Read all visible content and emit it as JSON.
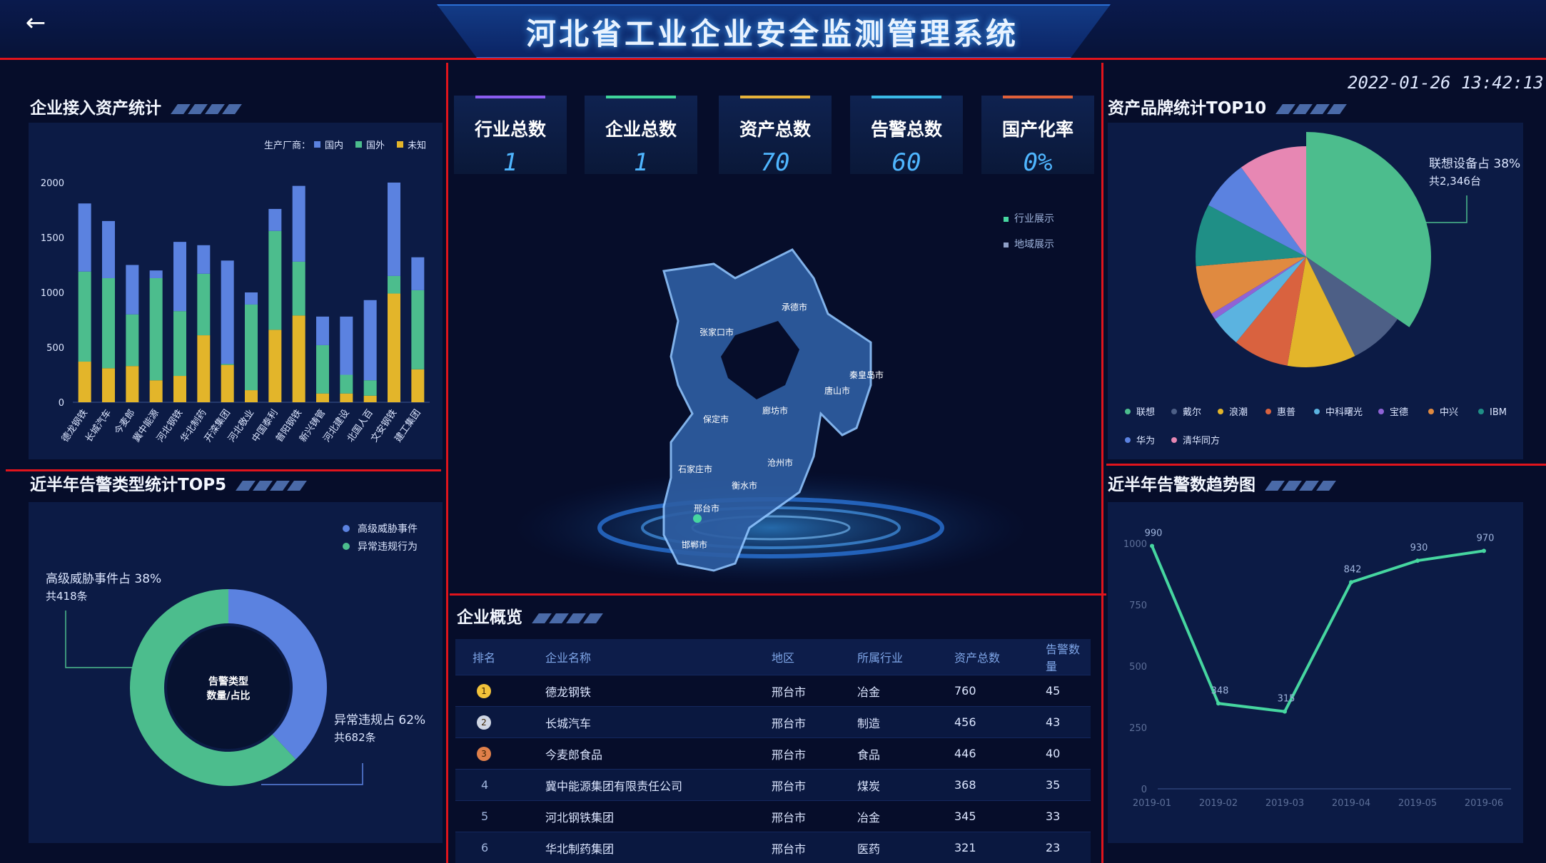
{
  "header": {
    "title": "河北省工业企业安全监测管理系统",
    "back_icon": "←"
  },
  "clock": "2022-01-26 13:42:13",
  "asset_panel": {
    "title": "企业接入资产统计",
    "legend_prefix": "生产厂商：",
    "chart_data": {
      "type": "bar",
      "stacked": true,
      "categories": [
        "德龙钢铁",
        "长城汽车",
        "今麦郎",
        "冀中能源",
        "河北钢铁",
        "华北制药",
        "开滦集团",
        "河北敬业",
        "中国泰利",
        "普阳钢铁",
        "新兴铸管",
        "河北建设",
        "北国人百",
        "文安钢铁",
        "建工集团"
      ],
      "series": [
        {
          "name": "国内",
          "color": "#5b82e0",
          "values": [
            620,
            520,
            450,
            70,
            630,
            260,
            940,
            110,
            200,
            690,
            260,
            530,
            730,
            850,
            300
          ]
        },
        {
          "name": "国外",
          "color": "#4cbd8d",
          "values": [
            820,
            820,
            470,
            930,
            590,
            560,
            10,
            780,
            900,
            490,
            440,
            170,
            140,
            160,
            720
          ]
        },
        {
          "name": "未知",
          "color": "#e3b52a",
          "values": [
            370,
            310,
            330,
            200,
            240,
            610,
            340,
            110,
            660,
            790,
            80,
            80,
            60,
            990,
            300
          ]
        }
      ],
      "ylim": [
        0,
        2000
      ],
      "yticks": [
        0,
        500,
        1000,
        1500,
        2000
      ],
      "grid": false
    }
  },
  "alarm_type_panel": {
    "title": "近半年告警类型统计TOP5",
    "center_label_1": "告警类型",
    "center_label_2": "数量/占比",
    "callout_a_1": "高级威胁事件占 38%",
    "callout_a_2": "共418条",
    "callout_b_1": "异常违规占 62%",
    "callout_b_2": "共682条",
    "chart_data": {
      "type": "pie",
      "donut": true,
      "slices": [
        {
          "name": "高级威胁事件",
          "value": 418,
          "percent": 38,
          "color": "#5b82e0"
        },
        {
          "name": "异常违规行为",
          "value": 682,
          "percent": 62,
          "color": "#4cbd8d"
        }
      ]
    }
  },
  "kpis": [
    {
      "label": "行业总数",
      "value": "1",
      "color": "#8a5cf0"
    },
    {
      "label": "企业总数",
      "value": "1",
      "color": "#3fd49a"
    },
    {
      "label": "资产总数",
      "value": "70",
      "color": "#e6b23a"
    },
    {
      "label": "告警总数",
      "value": "60",
      "color": "#3ab9e6"
    },
    {
      "label": "国产化率",
      "value": "0%",
      "color": "#e0603a"
    }
  ],
  "map_panel": {
    "legend": [
      "行业展示",
      "地域展示"
    ],
    "cities": [
      "承德市",
      "张家口市",
      "秦皇岛市",
      "唐山市",
      "廊坊市",
      "保定市",
      "沧州市",
      "石家庄市",
      "衡水市",
      "邢台市",
      "邯郸市"
    ]
  },
  "brand_panel": {
    "title": "资产品牌统计TOP10",
    "callout_1": "联想设备占 38%",
    "callout_2": "共2,346台",
    "chart_data": {
      "type": "pie",
      "slices": [
        {
          "name": "联想",
          "percent": 38,
          "color": "#4cbd8d"
        },
        {
          "name": "戴尔",
          "percent": 9,
          "color": "#4d5f86"
        },
        {
          "name": "浪潮",
          "percent": 11,
          "color": "#e3b52a"
        },
        {
          "name": "惠普",
          "percent": 9,
          "color": "#d9623f"
        },
        {
          "name": "中科曙光",
          "percent": 5,
          "color": "#5bb3e0"
        },
        {
          "name": "宝德",
          "percent": 1,
          "color": "#8f63d6"
        },
        {
          "name": "中兴",
          "percent": 8,
          "color": "#e08a40"
        },
        {
          "name": "IBM",
          "percent": 10,
          "color": "#1f8f86"
        },
        {
          "name": "华为",
          "percent": 8,
          "color": "#5b82e0"
        },
        {
          "name": "清华同方",
          "percent": 11,
          "color": "#e787b3"
        }
      ]
    }
  },
  "trend_panel": {
    "title": "近半年告警数趋势图",
    "chart_data": {
      "type": "line",
      "x": [
        "2019-01",
        "2019-02",
        "2019-03",
        "2019-04",
        "2019-05",
        "2019-06"
      ],
      "values": [
        990,
        348,
        315,
        842,
        930,
        970
      ],
      "ylim": [
        0,
        1000
      ],
      "yticks": [
        0,
        250,
        500,
        750,
        1000
      ],
      "color": "#46d6a0"
    }
  },
  "overview_panel": {
    "title": "企业概览",
    "columns": [
      "排名",
      "企业名称",
      "地区",
      "所属行业",
      "资产总数",
      "告警数量"
    ],
    "rows": [
      {
        "rank": "1",
        "name": "德龙钢铁",
        "region": "邢台市",
        "industry": "冶金",
        "assets": "760",
        "alarms": "45"
      },
      {
        "rank": "2",
        "name": "长城汽车",
        "region": "邢台市",
        "industry": "制造",
        "assets": "456",
        "alarms": "43"
      },
      {
        "rank": "3",
        "name": "今麦郎食品",
        "region": "邢台市",
        "industry": "食品",
        "assets": "446",
        "alarms": "40"
      },
      {
        "rank": "4",
        "name": "冀中能源集团有限责任公司",
        "region": "邢台市",
        "industry": "煤炭",
        "assets": "368",
        "alarms": "35"
      },
      {
        "rank": "5",
        "name": "河北钢铁集团",
        "region": "邢台市",
        "industry": "冶金",
        "assets": "345",
        "alarms": "33"
      },
      {
        "rank": "6",
        "name": "华北制药集团",
        "region": "邢台市",
        "industry": "医药",
        "assets": "321",
        "alarms": "23"
      }
    ]
  }
}
